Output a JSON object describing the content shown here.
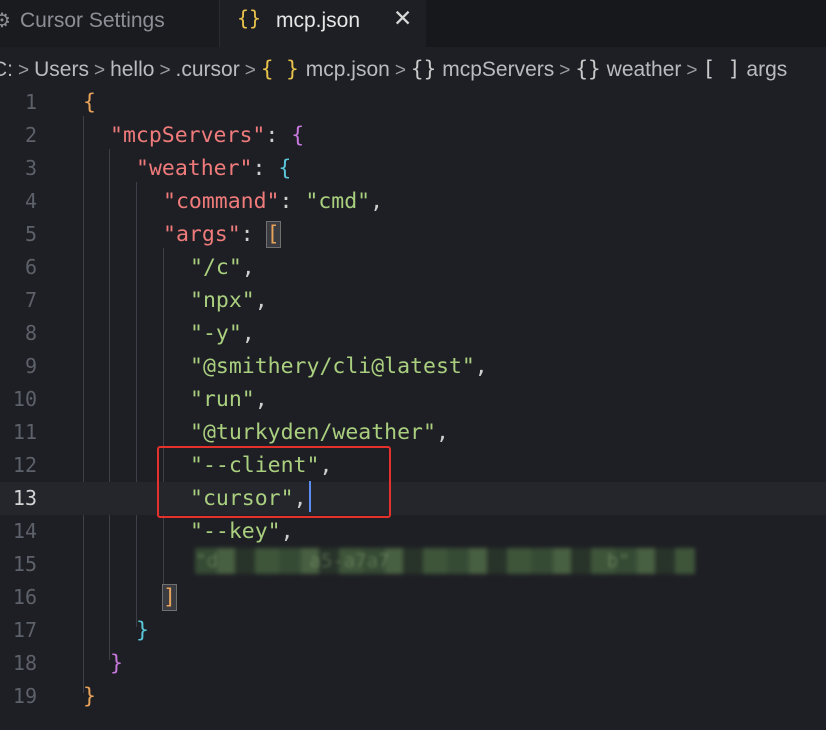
{
  "tabs": [
    {
      "label": "Cursor Settings",
      "active": false,
      "icon": "settings-icon"
    },
    {
      "label": "mcp.json",
      "active": true,
      "icon": "braces-icon"
    }
  ],
  "tab_close_glyph": "✕",
  "breadcrumb": [
    {
      "label": "C:",
      "icon": null
    },
    {
      "label": "Users",
      "icon": null
    },
    {
      "label": "hello",
      "icon": null
    },
    {
      "label": ".cursor",
      "icon": null
    },
    {
      "label": "mcp.json",
      "icon": "{ }"
    },
    {
      "label": "mcpServers",
      "icon": "{}"
    },
    {
      "label": "weather",
      "icon": "{}"
    },
    {
      "label": "args",
      "icon": "[ ]"
    }
  ],
  "editor": {
    "current_line": 13,
    "line_numbers": [
      "1",
      "2",
      "3",
      "4",
      "5",
      "6",
      "7",
      "8",
      "9",
      "10",
      "11",
      "12",
      "13",
      "14",
      "15",
      "16",
      "17",
      "18",
      "19"
    ],
    "lines": {
      "l1": "{",
      "l2_key": "\"mcpServers\"",
      "l2_colon": ": ",
      "l2_brace": "{",
      "l3_key": "\"weather\"",
      "l3_colon": ": ",
      "l3_brace": "{",
      "l4_key": "\"command\"",
      "l4_colon": ": ",
      "l4_val": "\"cmd\"",
      "l4_comma": ",",
      "l5_key": "\"args\"",
      "l5_colon": ": ",
      "l5_bracket": "[",
      "l6_val": "\"/c\"",
      "l7_val": "\"npx\"",
      "l8_val": "\"-y\"",
      "l9_val": "\"@smithery/cli@latest\"",
      "l10_val": "\"run\"",
      "l11_val": "\"@turkyden/weather\"",
      "l12_val": "\"--client\"",
      "l13_val": "\"cursor\"",
      "l14_val": "\"--key\"",
      "l15_redacted": "\"d        a5-a7a7                   b\"",
      "comma": ",",
      "l16": "]",
      "l17": "}",
      "l18": "}",
      "l19": "}"
    }
  },
  "colors": {
    "key": "#ef7b7b",
    "string": "#a9cf7f",
    "highlight_box": "#e5312c",
    "caret": "#5b8cf0"
  }
}
